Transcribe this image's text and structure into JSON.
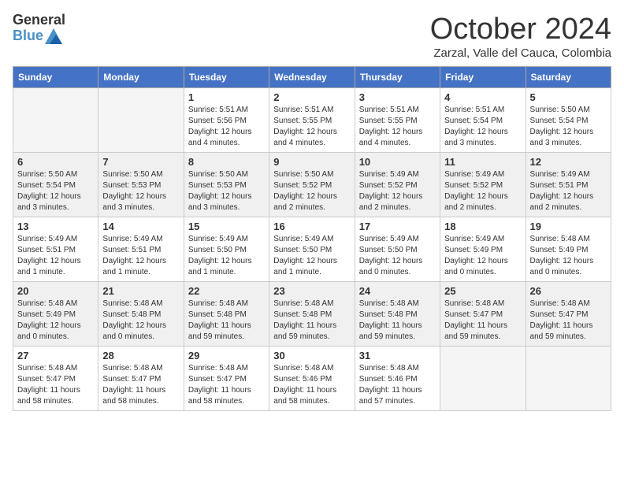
{
  "logo": {
    "general": "General",
    "blue": "Blue"
  },
  "title": "October 2024",
  "location": "Zarzal, Valle del Cauca, Colombia",
  "weekdays": [
    "Sunday",
    "Monday",
    "Tuesday",
    "Wednesday",
    "Thursday",
    "Friday",
    "Saturday"
  ],
  "weeks": [
    [
      {
        "day": "",
        "content": ""
      },
      {
        "day": "",
        "content": ""
      },
      {
        "day": "1",
        "content": "Sunrise: 5:51 AM\nSunset: 5:56 PM\nDaylight: 12 hours\nand 4 minutes."
      },
      {
        "day": "2",
        "content": "Sunrise: 5:51 AM\nSunset: 5:55 PM\nDaylight: 12 hours\nand 4 minutes."
      },
      {
        "day": "3",
        "content": "Sunrise: 5:51 AM\nSunset: 5:55 PM\nDaylight: 12 hours\nand 4 minutes."
      },
      {
        "day": "4",
        "content": "Sunrise: 5:51 AM\nSunset: 5:54 PM\nDaylight: 12 hours\nand 3 minutes."
      },
      {
        "day": "5",
        "content": "Sunrise: 5:50 AM\nSunset: 5:54 PM\nDaylight: 12 hours\nand 3 minutes."
      }
    ],
    [
      {
        "day": "6",
        "content": "Sunrise: 5:50 AM\nSunset: 5:54 PM\nDaylight: 12 hours\nand 3 minutes."
      },
      {
        "day": "7",
        "content": "Sunrise: 5:50 AM\nSunset: 5:53 PM\nDaylight: 12 hours\nand 3 minutes."
      },
      {
        "day": "8",
        "content": "Sunrise: 5:50 AM\nSunset: 5:53 PM\nDaylight: 12 hours\nand 3 minutes."
      },
      {
        "day": "9",
        "content": "Sunrise: 5:50 AM\nSunset: 5:52 PM\nDaylight: 12 hours\nand 2 minutes."
      },
      {
        "day": "10",
        "content": "Sunrise: 5:49 AM\nSunset: 5:52 PM\nDaylight: 12 hours\nand 2 minutes."
      },
      {
        "day": "11",
        "content": "Sunrise: 5:49 AM\nSunset: 5:52 PM\nDaylight: 12 hours\nand 2 minutes."
      },
      {
        "day": "12",
        "content": "Sunrise: 5:49 AM\nSunset: 5:51 PM\nDaylight: 12 hours\nand 2 minutes."
      }
    ],
    [
      {
        "day": "13",
        "content": "Sunrise: 5:49 AM\nSunset: 5:51 PM\nDaylight: 12 hours\nand 1 minute."
      },
      {
        "day": "14",
        "content": "Sunrise: 5:49 AM\nSunset: 5:51 PM\nDaylight: 12 hours\nand 1 minute."
      },
      {
        "day": "15",
        "content": "Sunrise: 5:49 AM\nSunset: 5:50 PM\nDaylight: 12 hours\nand 1 minute."
      },
      {
        "day": "16",
        "content": "Sunrise: 5:49 AM\nSunset: 5:50 PM\nDaylight: 12 hours\nand 1 minute."
      },
      {
        "day": "17",
        "content": "Sunrise: 5:49 AM\nSunset: 5:50 PM\nDaylight: 12 hours\nand 0 minutes."
      },
      {
        "day": "18",
        "content": "Sunrise: 5:49 AM\nSunset: 5:49 PM\nDaylight: 12 hours\nand 0 minutes."
      },
      {
        "day": "19",
        "content": "Sunrise: 5:48 AM\nSunset: 5:49 PM\nDaylight: 12 hours\nand 0 minutes."
      }
    ],
    [
      {
        "day": "20",
        "content": "Sunrise: 5:48 AM\nSunset: 5:49 PM\nDaylight: 12 hours\nand 0 minutes."
      },
      {
        "day": "21",
        "content": "Sunrise: 5:48 AM\nSunset: 5:48 PM\nDaylight: 12 hours\nand 0 minutes."
      },
      {
        "day": "22",
        "content": "Sunrise: 5:48 AM\nSunset: 5:48 PM\nDaylight: 11 hours\nand 59 minutes."
      },
      {
        "day": "23",
        "content": "Sunrise: 5:48 AM\nSunset: 5:48 PM\nDaylight: 11 hours\nand 59 minutes."
      },
      {
        "day": "24",
        "content": "Sunrise: 5:48 AM\nSunset: 5:48 PM\nDaylight: 11 hours\nand 59 minutes."
      },
      {
        "day": "25",
        "content": "Sunrise: 5:48 AM\nSunset: 5:47 PM\nDaylight: 11 hours\nand 59 minutes."
      },
      {
        "day": "26",
        "content": "Sunrise: 5:48 AM\nSunset: 5:47 PM\nDaylight: 11 hours\nand 59 minutes."
      }
    ],
    [
      {
        "day": "27",
        "content": "Sunrise: 5:48 AM\nSunset: 5:47 PM\nDaylight: 11 hours\nand 58 minutes."
      },
      {
        "day": "28",
        "content": "Sunrise: 5:48 AM\nSunset: 5:47 PM\nDaylight: 11 hours\nand 58 minutes."
      },
      {
        "day": "29",
        "content": "Sunrise: 5:48 AM\nSunset: 5:47 PM\nDaylight: 11 hours\nand 58 minutes."
      },
      {
        "day": "30",
        "content": "Sunrise: 5:48 AM\nSunset: 5:46 PM\nDaylight: 11 hours\nand 58 minutes."
      },
      {
        "day": "31",
        "content": "Sunrise: 5:48 AM\nSunset: 5:46 PM\nDaylight: 11 hours\nand 57 minutes."
      },
      {
        "day": "",
        "content": ""
      },
      {
        "day": "",
        "content": ""
      }
    ]
  ]
}
